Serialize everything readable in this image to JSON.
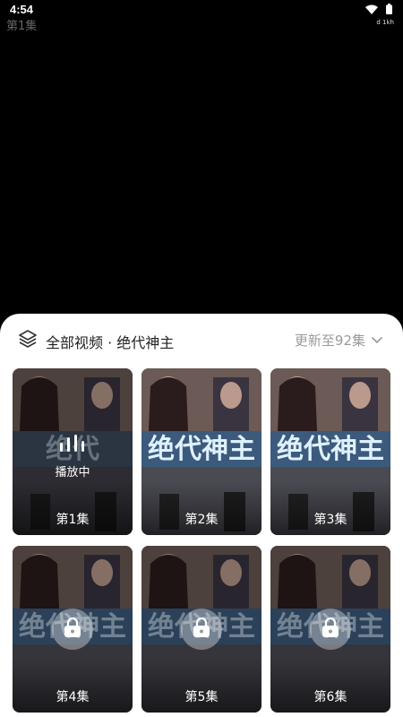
{
  "status": {
    "time": "4:54",
    "speed": "d 1kh"
  },
  "player": {
    "episode_title": "第1集"
  },
  "sheet": {
    "title": "全部视频 · 绝代神主",
    "update": "更新至92集"
  },
  "episodes": [
    {
      "label": "第1集",
      "state": "playing",
      "playing_text": "播放中"
    },
    {
      "label": "第2集",
      "state": "free"
    },
    {
      "label": "第3集",
      "state": "free"
    },
    {
      "label": "第4集",
      "state": "locked"
    },
    {
      "label": "第5集",
      "state": "locked"
    },
    {
      "label": "第6集",
      "state": "locked"
    }
  ],
  "icons": {
    "layers": "layers-icon",
    "chevron": "chevron-down-icon",
    "lock": "lock-icon",
    "playing": "playing-bars-icon"
  },
  "colors": {
    "sheet_bg": "#ffffff",
    "update_text": "#9a9a9a",
    "title_text": "#222222"
  }
}
